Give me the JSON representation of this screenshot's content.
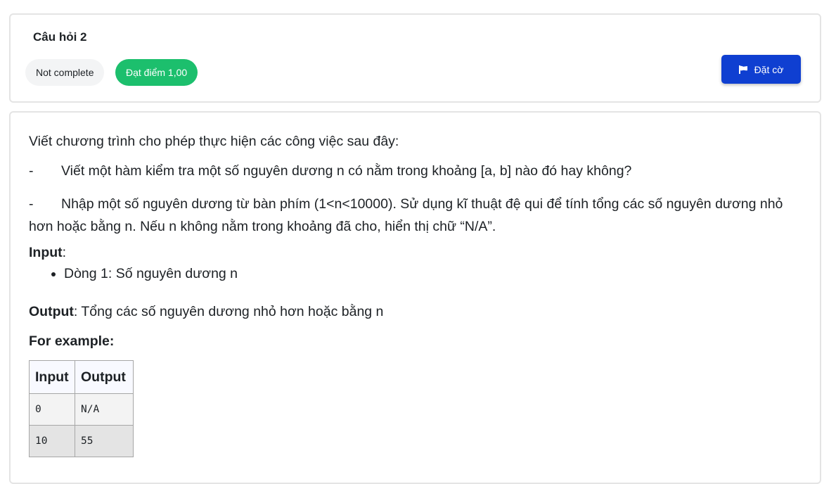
{
  "header": {
    "question_title": "Câu hỏi 2",
    "status_label": "Not complete",
    "grade_label": "Đạt điểm 1,00",
    "flag_label": "Đặt cờ",
    "flag_icon": "flag-icon",
    "colors": {
      "grade_badge": "#1cbf6d",
      "flag_button": "#0f3fd1",
      "status_badge": "#f3f4f5"
    }
  },
  "question": {
    "intro": "Viết chương trình cho phép thực hiện các công việc sau đây:",
    "tasks": [
      {
        "bullet": "-",
        "text": "Viết một hàm kiểm tra một số nguyên dương n có nằm trong khoảng [a, b] nào đó hay không?"
      },
      {
        "bullet": "-",
        "text": "Nhập một số nguyên dương từ bàn phím (1<n<10000). Sử dụng kĩ thuật đệ qui để tính tổng các số nguyên dương nhỏ hơn hoặc bằng n. Nếu n không nằm trong khoảng đã cho, hiển thị chữ “N/A”."
      }
    ],
    "input_heading": "Input",
    "input_colon": ":",
    "input_items": [
      "Dòng 1: Số nguyên dương n"
    ],
    "output_heading": "Output",
    "output_text": ": Tổng các số nguyên dương nhỏ hơn hoặc bằng n",
    "example_heading": "For example:",
    "example_table": {
      "headers": [
        "Input",
        "Output"
      ],
      "rows": [
        [
          "0",
          "N/A"
        ],
        [
          "10",
          "55"
        ]
      ]
    }
  }
}
